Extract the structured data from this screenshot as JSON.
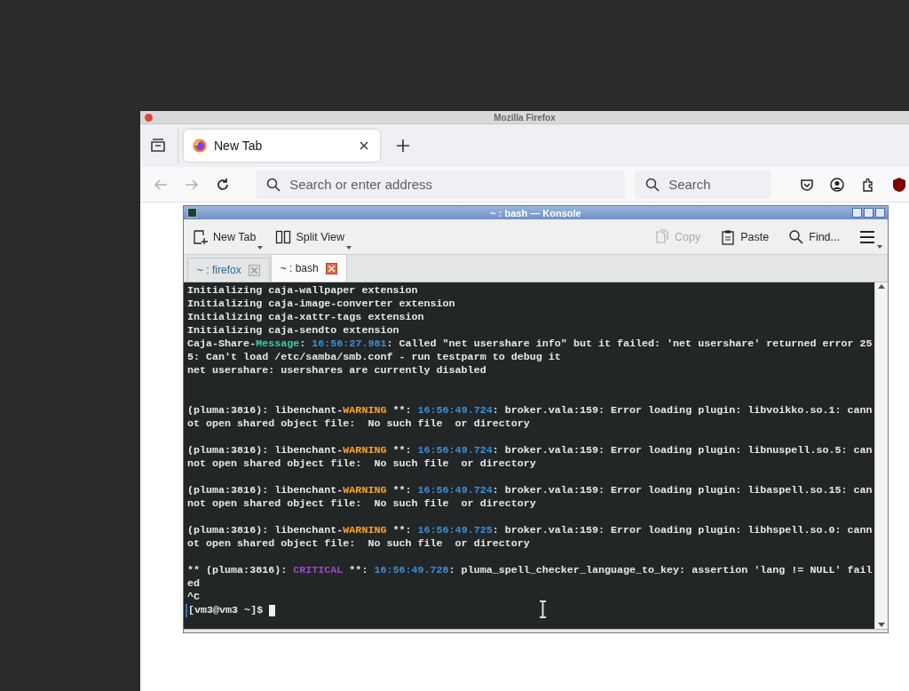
{
  "firefox": {
    "title": "Mozilla Firefox",
    "tabs": [
      {
        "label": "New Tab",
        "selected": true
      }
    ],
    "address": {
      "placeholder": "Search or enter address"
    },
    "search": {
      "placeholder": "Search"
    }
  },
  "konsole": {
    "title": "~ : bash — Konsole",
    "toolbar": [
      {
        "kind": "new-tab",
        "label": "New Tab",
        "disabled": false,
        "dropdown": true
      },
      {
        "kind": "split",
        "label": "Split View",
        "disabled": false,
        "dropdown": true
      },
      {
        "kind": "copy",
        "label": "Copy",
        "disabled": true,
        "dropdown": false
      },
      {
        "kind": "paste",
        "label": "Paste",
        "disabled": false,
        "dropdown": false
      },
      {
        "kind": "find",
        "label": "Find...",
        "disabled": false,
        "dropdown": false
      },
      {
        "kind": "menu",
        "disabled": false,
        "dropdown": true
      }
    ],
    "tabs": [
      {
        "label": "~ : firefox",
        "selected": false
      },
      {
        "label": "~ : bash",
        "selected": true
      }
    ],
    "lines": [
      {
        "kind": "text",
        "segments": [
          {
            "kind": "plain",
            "text": "Initializing caja-wallpaper extension"
          }
        ]
      },
      {
        "kind": "text",
        "segments": [
          {
            "kind": "plain",
            "text": "Initializing caja-image-converter extension"
          }
        ]
      },
      {
        "kind": "text",
        "segments": [
          {
            "kind": "plain",
            "text": "Initializing caja-xattr-tags extension"
          }
        ]
      },
      {
        "kind": "text",
        "segments": [
          {
            "kind": "plain",
            "text": "Initializing caja-sendto extension"
          }
        ]
      },
      {
        "kind": "text",
        "segments": [
          {
            "kind": "plain",
            "text": "Caja-Share-"
          },
          {
            "kind": "message",
            "text": "Message"
          },
          {
            "kind": "plain",
            "text": ": "
          },
          {
            "kind": "time",
            "text": "16:56:27.981"
          },
          {
            "kind": "plain",
            "text": ": Called \"net usershare info\" but it failed: 'net usershare' returned error 25"
          }
        ]
      },
      {
        "kind": "text",
        "segments": [
          {
            "kind": "plain",
            "text": "5: Can't load /etc/samba/smb.conf - run testparm to debug it"
          }
        ]
      },
      {
        "kind": "text",
        "segments": [
          {
            "kind": "plain",
            "text": "net usershare: usershares are currently disabled"
          }
        ]
      },
      {
        "kind": "blank"
      },
      {
        "kind": "blank"
      },
      {
        "kind": "text",
        "segments": [
          {
            "kind": "plain",
            "text": "(pluma:3816): libenchant-"
          },
          {
            "kind": "warning",
            "text": "WARNING"
          },
          {
            "kind": "plain",
            "text": " **: "
          },
          {
            "kind": "time",
            "text": "16:56:49.724"
          },
          {
            "kind": "plain",
            "text": ": broker.vala:159: Error loading plugin: libvoikko.so.1: cann"
          }
        ]
      },
      {
        "kind": "text",
        "segments": [
          {
            "kind": "plain",
            "text": "ot open shared object file:  No such file  or directory"
          }
        ]
      },
      {
        "kind": "blank"
      },
      {
        "kind": "text",
        "segments": [
          {
            "kind": "plain",
            "text": "(pluma:3816): libenchant-"
          },
          {
            "kind": "warning",
            "text": "WARNING"
          },
          {
            "kind": "plain",
            "text": " **: "
          },
          {
            "kind": "time",
            "text": "16:56:49.724"
          },
          {
            "kind": "plain",
            "text": ": broker.vala:159: Error loading plugin: libnuspell.so.5: can"
          }
        ]
      },
      {
        "kind": "text",
        "segments": [
          {
            "kind": "plain",
            "text": "not open shared object file:  No such file  or directory"
          }
        ]
      },
      {
        "kind": "blank"
      },
      {
        "kind": "text",
        "segments": [
          {
            "kind": "plain",
            "text": "(pluma:3816): libenchant-"
          },
          {
            "kind": "warning",
            "text": "WARNING"
          },
          {
            "kind": "plain",
            "text": " **: "
          },
          {
            "kind": "time",
            "text": "16:56:49.724"
          },
          {
            "kind": "plain",
            "text": ": broker.vala:159: Error loading plugin: libaspell.so.15: can"
          }
        ]
      },
      {
        "kind": "text",
        "segments": [
          {
            "kind": "plain",
            "text": "not open shared object file:  No such file  or directory"
          }
        ]
      },
      {
        "kind": "blank"
      },
      {
        "kind": "text",
        "segments": [
          {
            "kind": "plain",
            "text": "(pluma:3816): libenchant-"
          },
          {
            "kind": "warning",
            "text": "WARNING"
          },
          {
            "kind": "plain",
            "text": " **: "
          },
          {
            "kind": "time",
            "text": "16:56:49.725"
          },
          {
            "kind": "plain",
            "text": ": broker.vala:159: Error loading plugin: libhspell.so.0: cann"
          }
        ]
      },
      {
        "kind": "text",
        "segments": [
          {
            "kind": "plain",
            "text": "ot open shared object file:  No such file  or directory"
          }
        ]
      },
      {
        "kind": "blank"
      },
      {
        "kind": "text",
        "segments": [
          {
            "kind": "plain",
            "text": "** (pluma:3816): "
          },
          {
            "kind": "critical",
            "text": "CRITICAL"
          },
          {
            "kind": "plain",
            "text": " **: "
          },
          {
            "kind": "time",
            "text": "16:56:49.728"
          },
          {
            "kind": "plain",
            "text": ": pluma_spell_checker_language_to_key: assertion 'lang != NULL' fail"
          }
        ]
      },
      {
        "kind": "text",
        "segments": [
          {
            "kind": "plain",
            "text": "ed"
          }
        ]
      },
      {
        "kind": "text",
        "segments": [
          {
            "kind": "plain",
            "text": "^C"
          }
        ]
      },
      {
        "kind": "prompt",
        "text": "[vm3@vm3 ~]$"
      }
    ]
  }
}
